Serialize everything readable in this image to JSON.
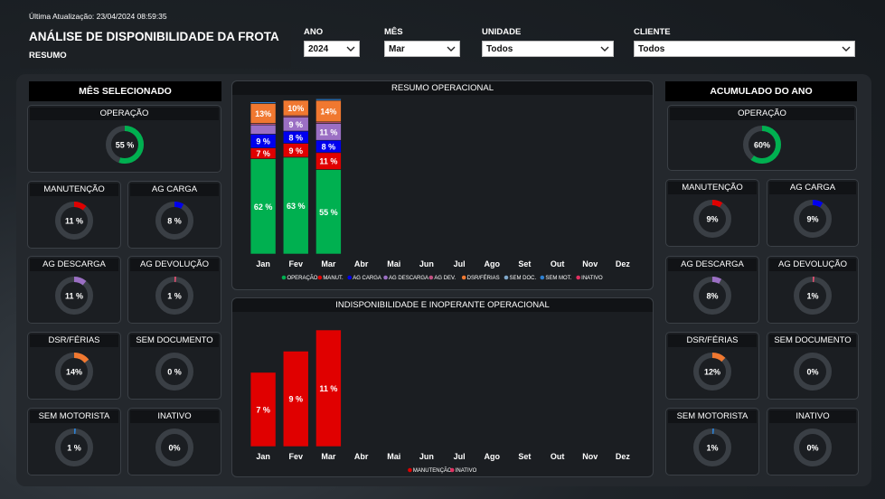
{
  "header": {
    "last_update": "Última Atualização: 23/04/2024 08:59:35",
    "title": "ANÁLISE DE DISPONIBILIDADE DA FROTA",
    "subtitle": "RESUMO"
  },
  "filters": {
    "ano": {
      "label": "ANO",
      "value": "2024"
    },
    "mes": {
      "label": "MÊS",
      "value": "Mar"
    },
    "unidade": {
      "label": "UNIDADE",
      "value": "Todos"
    },
    "cliente": {
      "label": "CLIENTE",
      "value": "Todos"
    }
  },
  "left": {
    "header": "MÊS SELECIONADO",
    "cards": [
      {
        "title": "OPERAÇÃO",
        "label": "55 %",
        "value": 55,
        "color": "#00b050"
      },
      {
        "title": "MANUTENÇÃO",
        "label": "11 %",
        "value": 11,
        "color": "#e00000"
      },
      {
        "title": "AG CARGA",
        "label": "8 %",
        "value": 8,
        "color": "#0000ee"
      },
      {
        "title": "AG DESCARGA",
        "label": "11 %",
        "value": 11,
        "color": "#9b6fc4"
      },
      {
        "title": "AG DEVOLUÇÃO",
        "label": "1 %",
        "value": 1,
        "color": "#e05070"
      },
      {
        "title": "DSR/FÉRIAS",
        "label": "14%",
        "value": 14,
        "color": "#f07830"
      },
      {
        "title": "SEM DOCUMENTO",
        "label": "0 %",
        "value": 0,
        "color": "#7fa7c9"
      },
      {
        "title": "SEM MOTORISTA",
        "label": "1 %",
        "value": 1,
        "color": "#2d7fd0"
      },
      {
        "title": "INATIVO",
        "label": "0%",
        "value": 0,
        "color": "#e03060"
      }
    ]
  },
  "right": {
    "header": "ACUMULADO DO ANO",
    "cards": [
      {
        "title": "OPERAÇÃO",
        "label": "60%",
        "value": 60,
        "color": "#00b050"
      },
      {
        "title": "MANUTENÇÃO",
        "label": "9%",
        "value": 9,
        "color": "#e00000"
      },
      {
        "title": "AG CARGA",
        "label": "9%",
        "value": 9,
        "color": "#0000ee"
      },
      {
        "title": "AG DESCARGA",
        "label": "8%",
        "value": 8,
        "color": "#9b6fc4"
      },
      {
        "title": "AG DEVOLUÇÃO",
        "label": "1%",
        "value": 1,
        "color": "#e05070"
      },
      {
        "title": "DSR/FÉRIAS",
        "label": "12%",
        "value": 12,
        "color": "#f07830"
      },
      {
        "title": "SEM DOCUMENTO",
        "label": "0%",
        "value": 0,
        "color": "#7fa7c9"
      },
      {
        "title": "SEM MOTORISTA",
        "label": "1%",
        "value": 1,
        "color": "#2d7fd0"
      },
      {
        "title": "INATIVO",
        "label": "0%",
        "value": 0,
        "color": "#e03060"
      }
    ]
  },
  "chart_data": [
    {
      "type": "bar",
      "stacked": true,
      "title": "RESUMO OPERACIONAL",
      "categories": [
        "Jan",
        "Fev",
        "Mar",
        "Abr",
        "Mai",
        "Jun",
        "Jul",
        "Ago",
        "Set",
        "Out",
        "Nov",
        "Dez"
      ],
      "series": [
        {
          "name": "OPERAÇÃO",
          "color": "#00b050",
          "values": [
            62,
            63,
            55,
            null,
            null,
            null,
            null,
            null,
            null,
            null,
            null,
            null
          ],
          "labels": [
            "62 %",
            "63 %",
            "55 %"
          ]
        },
        {
          "name": "MANUT.",
          "color": "#e00000",
          "values": [
            7,
            9,
            11,
            null,
            null,
            null,
            null,
            null,
            null,
            null,
            null,
            null
          ],
          "labels": [
            "7 %",
            "9 %",
            "11 %"
          ]
        },
        {
          "name": "AG CARGA",
          "color": "#0000ee",
          "values": [
            9,
            8,
            8,
            null,
            null,
            null,
            null,
            null,
            null,
            null,
            null,
            null
          ],
          "labels": [
            "9 %",
            "8 %",
            "8 %"
          ]
        },
        {
          "name": "AG DESCARGA",
          "color": "#9b6fc4",
          "values": [
            6,
            9,
            11,
            null,
            null,
            null,
            null,
            null,
            null,
            null,
            null,
            null
          ],
          "labels": [
            "",
            "9 %",
            "11 %"
          ]
        },
        {
          "name": "AG DEV.",
          "color": "#c05080",
          "values": [
            1,
            1,
            1,
            null,
            null,
            null,
            null,
            null,
            null,
            null,
            null,
            null
          ],
          "labels": [
            "",
            "",
            ""
          ]
        },
        {
          "name": "DSR/FÉRIAS",
          "color": "#f07830",
          "values": [
            13,
            10,
            14,
            null,
            null,
            null,
            null,
            null,
            null,
            null,
            null,
            null
          ],
          "labels": [
            "13%",
            "10%",
            "14%"
          ]
        },
        {
          "name": "SEM DOC.",
          "color": "#7fa7c9",
          "values": [
            0,
            0,
            0,
            null,
            null,
            null,
            null,
            null,
            null,
            null,
            null,
            null
          ],
          "labels": [
            "",
            "",
            ""
          ]
        },
        {
          "name": "SEM MOT.",
          "color": "#2d7fd0",
          "values": [
            1,
            0,
            1,
            null,
            null,
            null,
            null,
            null,
            null,
            null,
            null,
            null
          ],
          "labels": [
            "",
            "",
            ""
          ]
        },
        {
          "name": "INATIVO",
          "color": "#e03060",
          "values": [
            0,
            0,
            0,
            null,
            null,
            null,
            null,
            null,
            null,
            null,
            null,
            null
          ],
          "labels": [
            "",
            "",
            ""
          ]
        }
      ],
      "ylim": [
        0,
        100
      ],
      "legend": "bottom"
    },
    {
      "type": "bar",
      "stacked": true,
      "title": "INDISPONIBILIDADE E INOPERANTE OPERACIONAL",
      "categories": [
        "Jan",
        "Fev",
        "Mar",
        "Abr",
        "Mai",
        "Jun",
        "Jul",
        "Ago",
        "Set",
        "Out",
        "Nov",
        "Dez"
      ],
      "series": [
        {
          "name": "MANUTENÇÃO",
          "color": "#e00000",
          "values": [
            7,
            9,
            11,
            null,
            null,
            null,
            null,
            null,
            null,
            null,
            null,
            null
          ],
          "labels": [
            "7 %",
            "9 %",
            "11 %"
          ]
        },
        {
          "name": "INATIVO",
          "color": "#e03060",
          "values": [
            0,
            0,
            0,
            null,
            null,
            null,
            null,
            null,
            null,
            null,
            null,
            null
          ],
          "labels": [
            "",
            "",
            ""
          ]
        }
      ],
      "ylim": [
        0,
        11
      ],
      "legend": "bottom"
    }
  ]
}
